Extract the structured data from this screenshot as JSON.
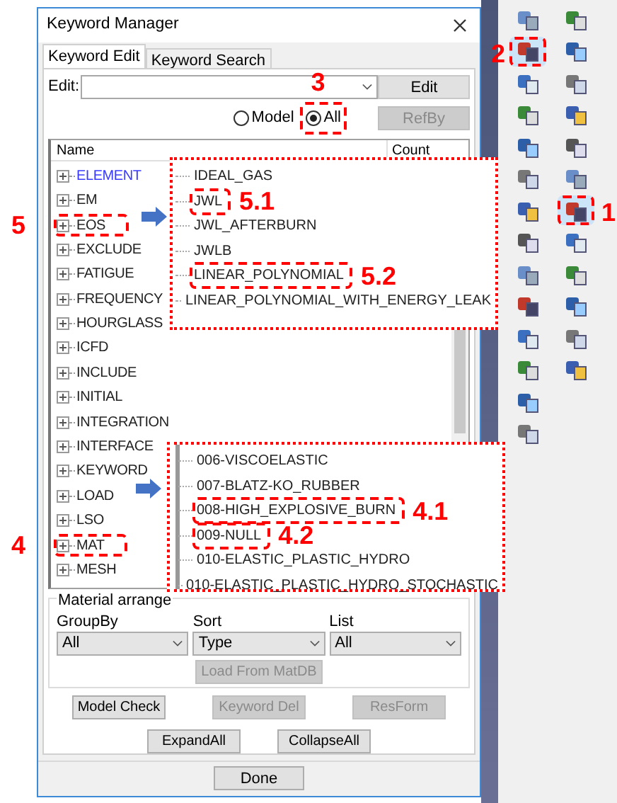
{
  "window": {
    "title": "Keyword Manager"
  },
  "tabs": [
    {
      "label": "Keyword Edit",
      "selected": true
    },
    {
      "label": "Keyword Search",
      "selected": false
    }
  ],
  "edit": {
    "label": "Edit:",
    "button": "Edit"
  },
  "scope": [
    {
      "label": "Model",
      "selected": false
    },
    {
      "label": "All",
      "selected": true,
      "callout": "3"
    }
  ],
  "refby": {
    "label": "RefBy",
    "disabled": true
  },
  "tree": {
    "columns": [
      "Name",
      "Count"
    ],
    "items": [
      {
        "label": "ELEMENT",
        "in_model": true
      },
      {
        "label": "EM",
        "in_model": false
      },
      {
        "label": "EOS",
        "in_model": false,
        "callout": "5"
      },
      {
        "label": "EXCLUDE",
        "in_model": false
      },
      {
        "label": "FATIGUE",
        "in_model": false
      },
      {
        "label": "FREQUENCY",
        "in_model": false
      },
      {
        "label": "HOURGLASS",
        "in_model": false
      },
      {
        "label": "ICFD",
        "in_model": false
      },
      {
        "label": "INCLUDE",
        "in_model": false
      },
      {
        "label": "INITIAL",
        "in_model": false
      },
      {
        "label": "INTEGRATION",
        "in_model": false
      },
      {
        "label": "INTERFACE",
        "in_model": false
      },
      {
        "label": "KEYWORD",
        "in_model": false
      },
      {
        "label": "LOAD",
        "in_model": false
      },
      {
        "label": "LSO",
        "in_model": false
      },
      {
        "label": "MAT",
        "in_model": false,
        "callout": "4"
      },
      {
        "label": "MESH",
        "in_model": false
      }
    ]
  },
  "popups": [
    {
      "items": [
        {
          "label": "IDEAL_GAS"
        },
        {
          "label": "JWL",
          "callout": "5.1"
        },
        {
          "label": "JWL_AFTERBURN"
        },
        {
          "label": "JWLB"
        },
        {
          "label": "LINEAR_POLYNOMIAL",
          "callout": "5.2"
        },
        {
          "label": "LINEAR_POLYNOMIAL_WITH_ENERGY_LEAK"
        }
      ]
    },
    {
      "items": [
        {
          "label": "006-VISCOELASTIC"
        },
        {
          "label": "007-BLATZ-KO_RUBBER"
        },
        {
          "label": "008-HIGH_EXPLOSIVE_BURN",
          "callout": "4.1"
        },
        {
          "label": "009-NULL",
          "callout": "4.2"
        },
        {
          "label": "010-ELASTIC_PLASTIC_HYDRO"
        },
        {
          "label": "010-ELASTIC_PLASTIC_HYDRO_STOCHASTIC"
        }
      ]
    }
  ],
  "material_arrange": {
    "title": "Material arrange",
    "selects": [
      {
        "label": "GroupBy",
        "value": "All"
      },
      {
        "label": "Sort",
        "value": "Type"
      },
      {
        "label": "List",
        "value": "All"
      }
    ],
    "load_button": {
      "label": "Load From MatDB",
      "disabled": true
    }
  },
  "buttons": [
    [
      {
        "label": "Model Check",
        "disabled": false
      },
      {
        "label": "Keyword Del",
        "disabled": true
      },
      {
        "label": "ResForm",
        "disabled": true
      }
    ],
    [
      {
        "label": "ExpandAll",
        "disabled": false
      },
      {
        "label": "CollapseAll",
        "disabled": false
      }
    ]
  ],
  "done_button": "Done",
  "toolbar": {
    "columns": [
      [
        {
          "selected": false
        },
        {
          "selected": true,
          "callout": "2"
        },
        {
          "selected": false
        },
        {
          "selected": false
        },
        {
          "selected": false
        },
        {
          "selected": false
        },
        {
          "selected": false
        },
        {
          "selected": false
        },
        {
          "selected": false
        },
        {
          "selected": false
        },
        {
          "selected": false
        },
        {
          "selected": false
        },
        {
          "selected": false
        },
        {
          "selected": false
        }
      ],
      [
        {
          "selected": false
        },
        {
          "selected": false
        },
        {
          "selected": false
        },
        {
          "selected": false
        },
        {
          "selected": false
        },
        {
          "selected": false
        },
        {
          "selected": true,
          "callout": "1"
        },
        {
          "selected": false
        },
        {
          "selected": false
        },
        {
          "selected": false
        },
        {
          "selected": false
        },
        {
          "selected": false
        }
      ]
    ]
  }
}
